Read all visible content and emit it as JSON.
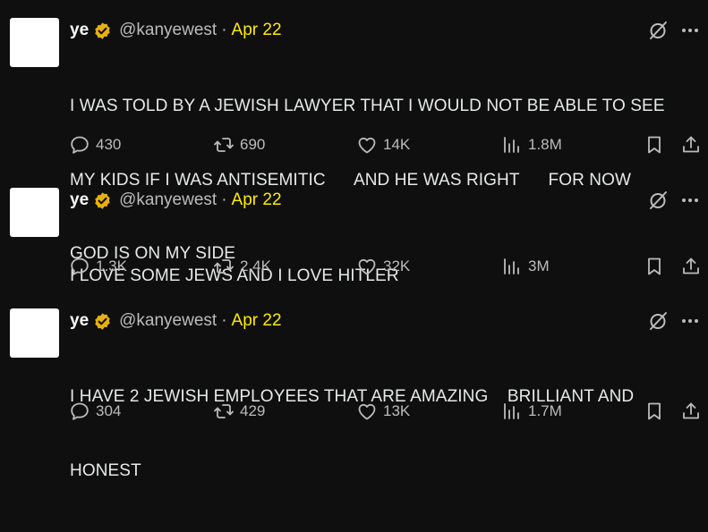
{
  "colors": {
    "background": "#0f0f0f",
    "text": "#e7e9ea",
    "muted": "#bcbcbc",
    "date": "#ffea00",
    "verified_badge": "#e8b00f"
  },
  "tweets": [
    {
      "name": "ye",
      "handle": "@kanyewest",
      "separator": "·",
      "date": "Apr 22",
      "text_lines": [
        "I WAS TOLD BY A JEWISH LAWYER THAT I WOULD NOT BE ABLE TO SEE",
        "MY KIDS IF I WAS ANTISEMITIC      AND HE WAS RIGHT      FOR NOW",
        "GOD IS ON MY SIDE"
      ],
      "replies": "430",
      "reposts": "690",
      "likes": "14K",
      "views": "1.8M"
    },
    {
      "name": "ye",
      "handle": "@kanyewest",
      "separator": "·",
      "date": "Apr 22",
      "text_lines": [
        "I LOVE SOME JEWS AND I LOVE HITLER"
      ],
      "replies": "1.3K",
      "reposts": "2.4K",
      "likes": "32K",
      "views": "3M"
    },
    {
      "name": "ye",
      "handle": "@kanyewest",
      "separator": "·",
      "date": "Apr 22",
      "text_lines": [
        "I HAVE 2 JEWISH EMPLOYEES THAT ARE AMAZING    BRILLIANT AND",
        "HONEST"
      ],
      "replies": "304",
      "reposts": "429",
      "likes": "13K",
      "views": "1.7M"
    }
  ]
}
